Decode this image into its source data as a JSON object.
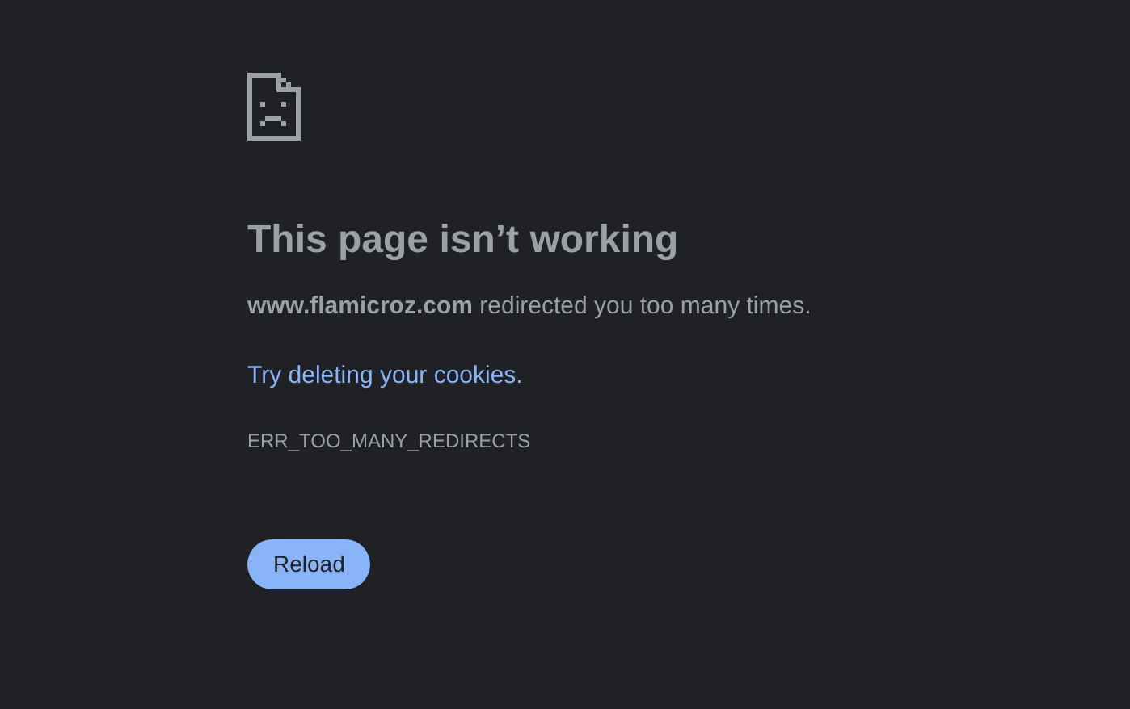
{
  "title": "This page isn’t working",
  "message": "**www.flamicroz.com** redirected you too many times.",
  "suggestion_link": "Try deleting your cookies.",
  "error_code": "ERR_TOO_MANY_REDIRECTS",
  "buttons": [
    "Reload"
  ]
}
